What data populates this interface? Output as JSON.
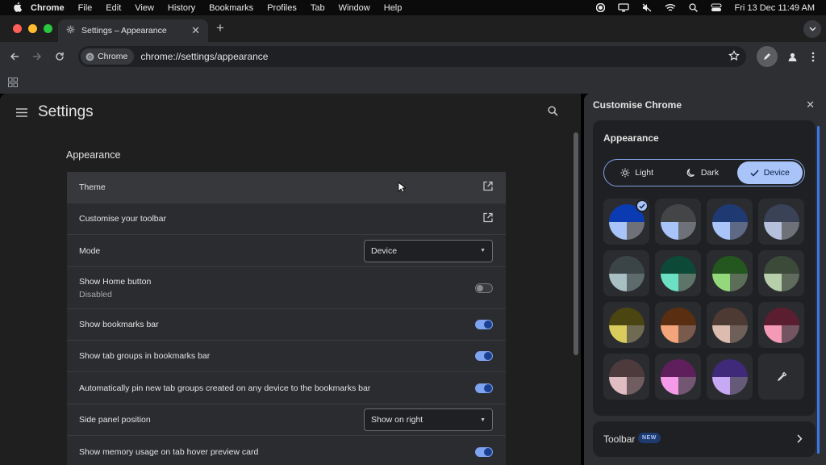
{
  "menubar": {
    "app_name": "Chrome",
    "menus": [
      "File",
      "Edit",
      "View",
      "History",
      "Bookmarks",
      "Profiles",
      "Tab",
      "Window",
      "Help"
    ],
    "datetime": "Fri 13 Dec  11:49 AM"
  },
  "tab": {
    "title": "Settings – Appearance",
    "close": "✕",
    "new_tab": "+"
  },
  "omnibox": {
    "chip_label": "Chrome",
    "url": "chrome://settings/appearance"
  },
  "settings": {
    "title": "Settings",
    "section": "Appearance",
    "rows": [
      {
        "label": "Theme",
        "control": "external"
      },
      {
        "label": "Customise your toolbar",
        "control": "external"
      },
      {
        "label": "Mode",
        "control": "dropdown",
        "value": "Device"
      },
      {
        "label": "Show Home button",
        "sublabel": "Disabled",
        "control": "toggle",
        "on": false
      },
      {
        "label": "Show bookmarks bar",
        "control": "toggle",
        "on": true
      },
      {
        "label": "Show tab groups in bookmarks bar",
        "control": "toggle",
        "on": true
      },
      {
        "label": "Automatically pin new tab groups created on any device to the bookmarks bar",
        "control": "toggle",
        "on": true
      },
      {
        "label": "Side panel position",
        "control": "dropdown",
        "value": "Show on right"
      },
      {
        "label": "Show memory usage on tab hover preview card",
        "control": "toggle",
        "on": true
      }
    ]
  },
  "panel": {
    "title": "Customise Chrome",
    "appearance_title": "Appearance",
    "modes": [
      {
        "label": "Light",
        "icon": "sun-icon",
        "selected": false
      },
      {
        "label": "Dark",
        "icon": "moon-icon",
        "selected": false
      },
      {
        "label": "Device",
        "icon": "check-icon",
        "selected": true
      }
    ],
    "swatches": [
      {
        "top": "#0b3bb3",
        "bl": "#a8c4f8",
        "br": "#6f7178",
        "selected": true
      },
      {
        "top": "#444547",
        "bl": "#a8c4f8",
        "br": "#6f7178"
      },
      {
        "top": "#1f3a73",
        "bl": "#a8c4f8",
        "br": "#5e6a85"
      },
      {
        "top": "#3a4257",
        "bl": "#b5c0dd",
        "br": "#6f7178"
      },
      {
        "top": "#3b4547",
        "bl": "#a8c0c3",
        "br": "#5e6b6c"
      },
      {
        "top": "#0c4a37",
        "bl": "#6be0c3",
        "br": "#5d7468"
      },
      {
        "top": "#24561f",
        "bl": "#93d87a",
        "br": "#5d6e58"
      },
      {
        "top": "#3c4a3a",
        "bl": "#b8cfac",
        "br": "#5f6b5c"
      },
      {
        "top": "#4b4512",
        "bl": "#d9cc5d",
        "br": "#6f6b52"
      },
      {
        "top": "#5a2e10",
        "bl": "#f2a57a",
        "br": "#7a5a4d"
      },
      {
        "top": "#4d3a33",
        "bl": "#dcbcae",
        "br": "#6f5f59"
      },
      {
        "top": "#5a1e30",
        "bl": "#f59ab6",
        "br": "#725561"
      },
      {
        "top": "#4d3a3d",
        "bl": "#e0bcc3",
        "br": "#6f5d61"
      },
      {
        "top": "#5e1f5c",
        "bl": "#f59ae8",
        "br": "#725672"
      },
      {
        "top": "#3f2a7a",
        "bl": "#c7a8f5",
        "br": "#655a78"
      },
      {
        "custom": true
      }
    ],
    "toolbar_label": "Toolbar",
    "toolbar_badge": "NEW"
  },
  "colors": {
    "accent": "#a8c4f8",
    "toggle_on": "#7ea4f0",
    "close_red": "#ff5f57",
    "minimize_yellow": "#febc2e",
    "zoom_green": "#28c840"
  }
}
